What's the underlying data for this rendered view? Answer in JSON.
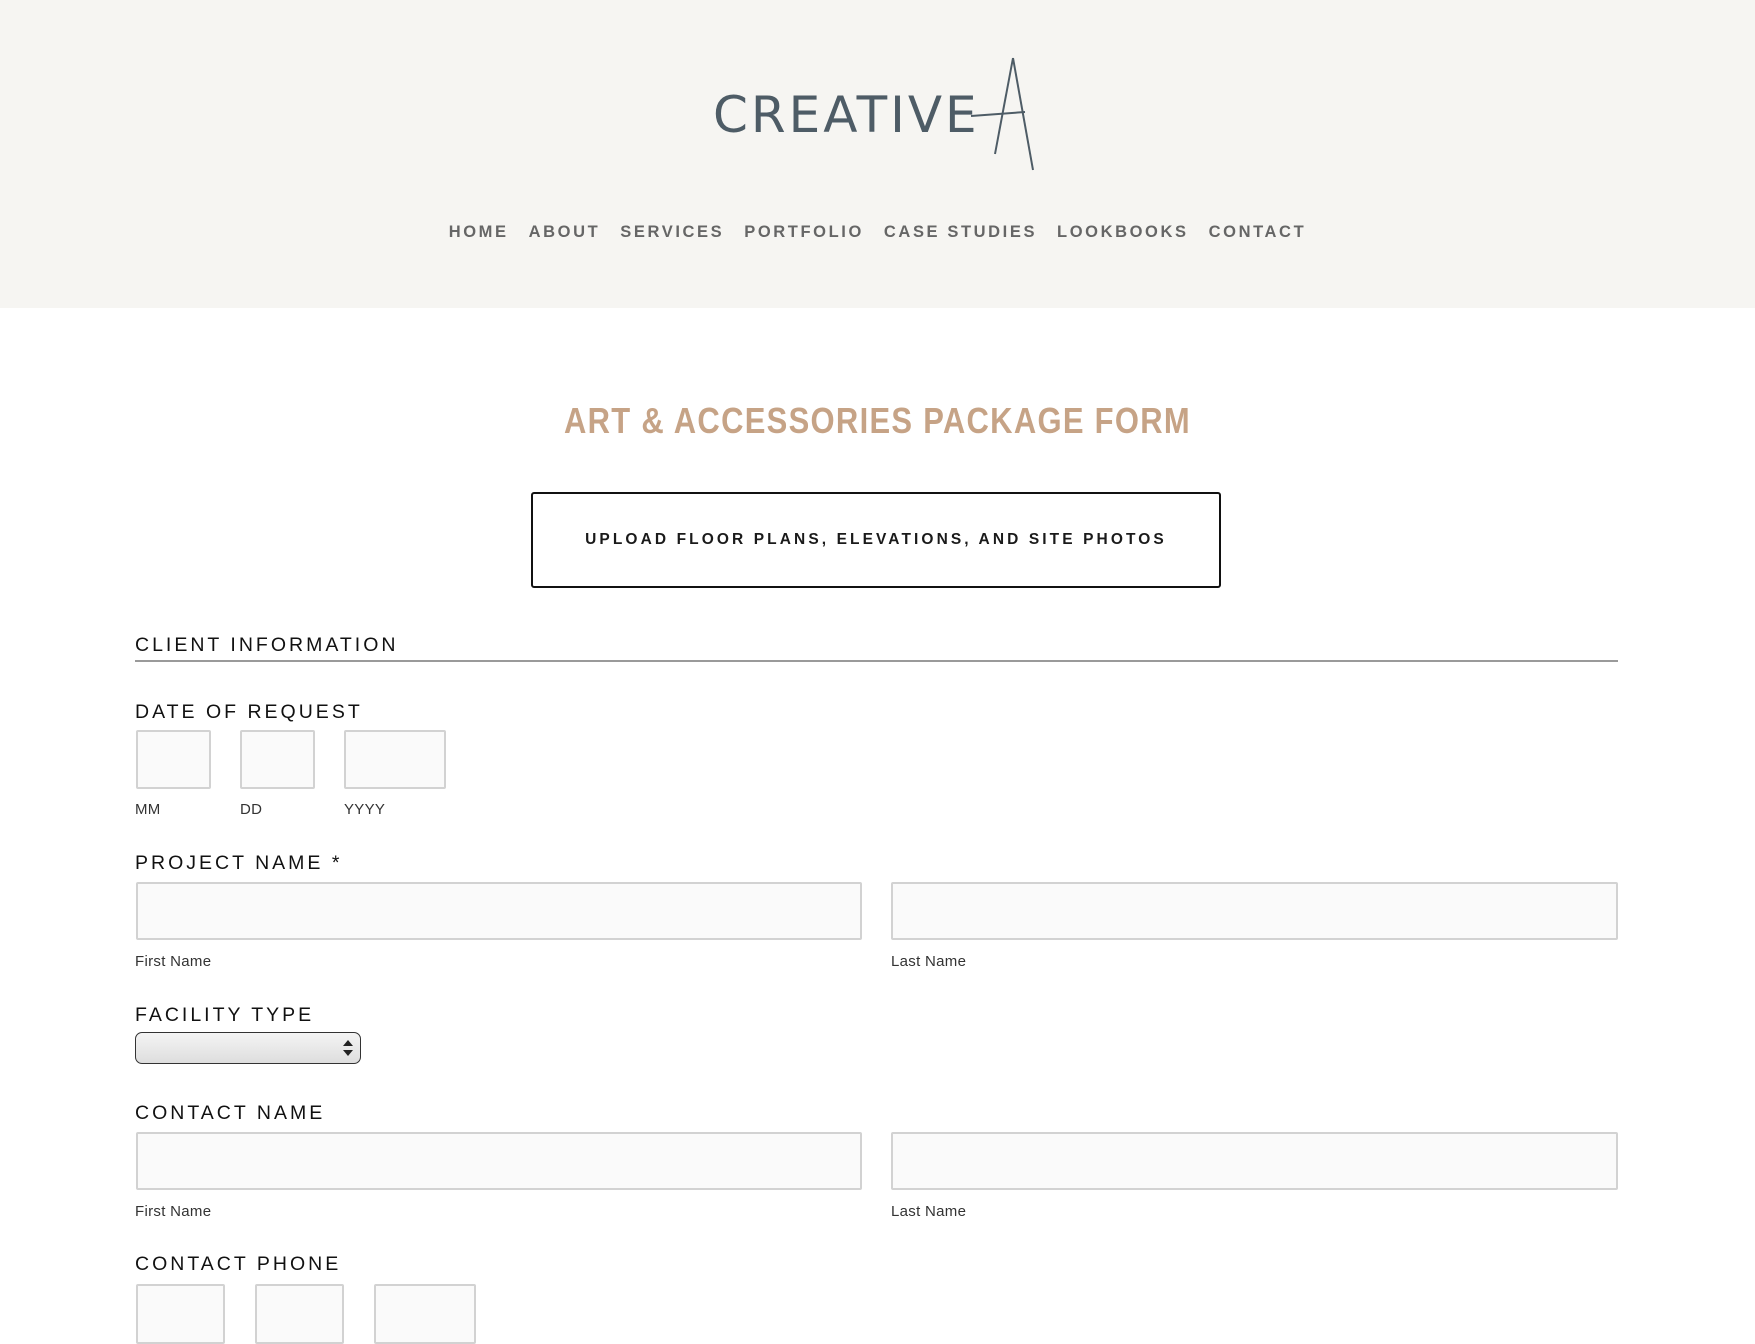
{
  "brand": {
    "logo_text": "CREATIVE",
    "logo_color": "#4e5c66"
  },
  "nav": {
    "items": [
      "HOME",
      "ABOUT",
      "SERVICES",
      "PORTFOLIO",
      "CASE STUDIES",
      "LOOKBOOKS",
      "CONTACT"
    ]
  },
  "form": {
    "title": "ART & ACCESSORIES PACKAGE FORM",
    "title_color": "#c6a386",
    "upload_label": "UPLOAD FLOOR PLANS, ELEVATIONS, AND SITE PHOTOS",
    "section_heading": "CLIENT INFORMATION",
    "date_of_request": {
      "label": "DATE OF REQUEST",
      "mm": "MM",
      "dd": "DD",
      "yyyy": "YYYY",
      "values": {
        "mm": "",
        "dd": "",
        "yyyy": ""
      }
    },
    "project_name": {
      "label": "PROJECT NAME *",
      "first_label": "First Name",
      "last_label": "Last Name",
      "values": {
        "first": "",
        "last": ""
      }
    },
    "facility_type": {
      "label": "FACILITY TYPE",
      "selected": ""
    },
    "contact_name": {
      "label": "CONTACT NAME",
      "first_label": "First Name",
      "last_label": "Last Name",
      "values": {
        "first": "",
        "last": ""
      }
    },
    "contact_phone": {
      "label": "CONTACT PHONE"
    }
  }
}
